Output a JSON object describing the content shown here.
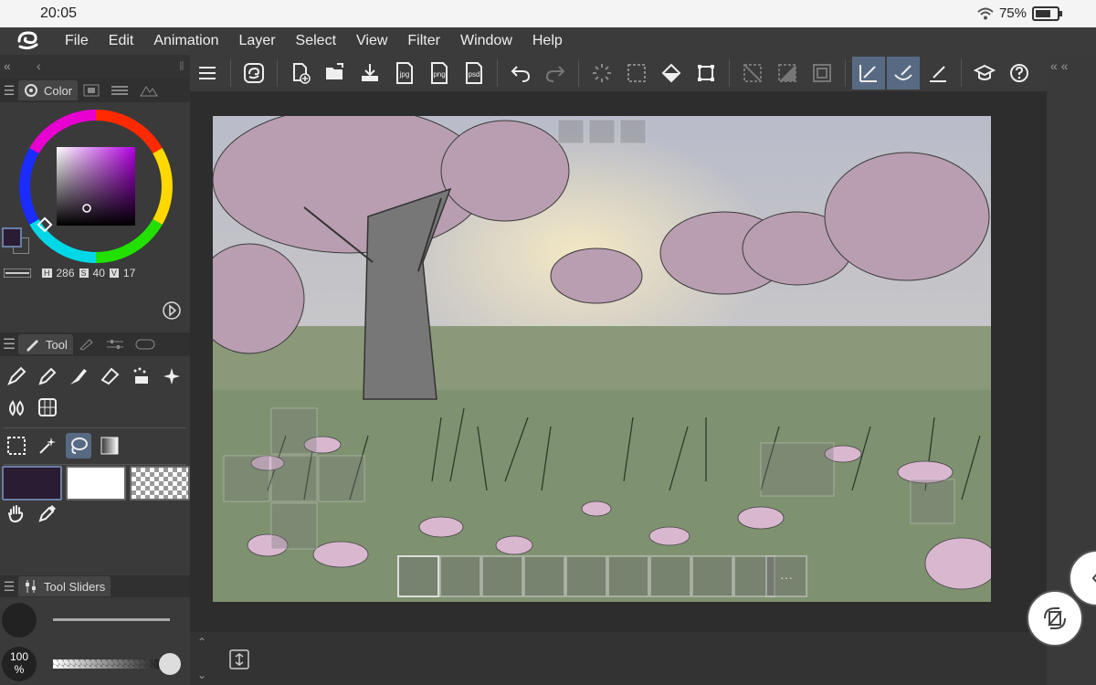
{
  "status": {
    "time": "20:05",
    "battery": "75%"
  },
  "menu": [
    "File",
    "Edit",
    "Animation",
    "Layer",
    "Select",
    "View",
    "Filter",
    "Window",
    "Help"
  ],
  "color_panel": {
    "tab_label": "Color",
    "h_label": "H",
    "h_value": "286",
    "s_label": "S",
    "s_value": "40",
    "v_label": "V",
    "v_value": "17",
    "main_color": "#2a1c33",
    "sub_color": "#ffffff"
  },
  "tool_panel": {
    "tab_label": "Tool"
  },
  "sliders_panel": {
    "tab_label": "Tool Sliders",
    "opacity_value": "100",
    "opacity_unit": "%"
  },
  "toolbar": {
    "jpg_label": "jpg",
    "png_label": "png",
    "psd_label": "psd"
  },
  "canvas": {
    "hotbar_dots": "···"
  },
  "icons": [
    "menu-icon",
    "quick-access-icon",
    "new-icon",
    "open-icon",
    "save-icon",
    "export-jpg-icon",
    "export-png-icon",
    "export-psd-icon",
    "undo-icon",
    "redo-icon"
  ]
}
